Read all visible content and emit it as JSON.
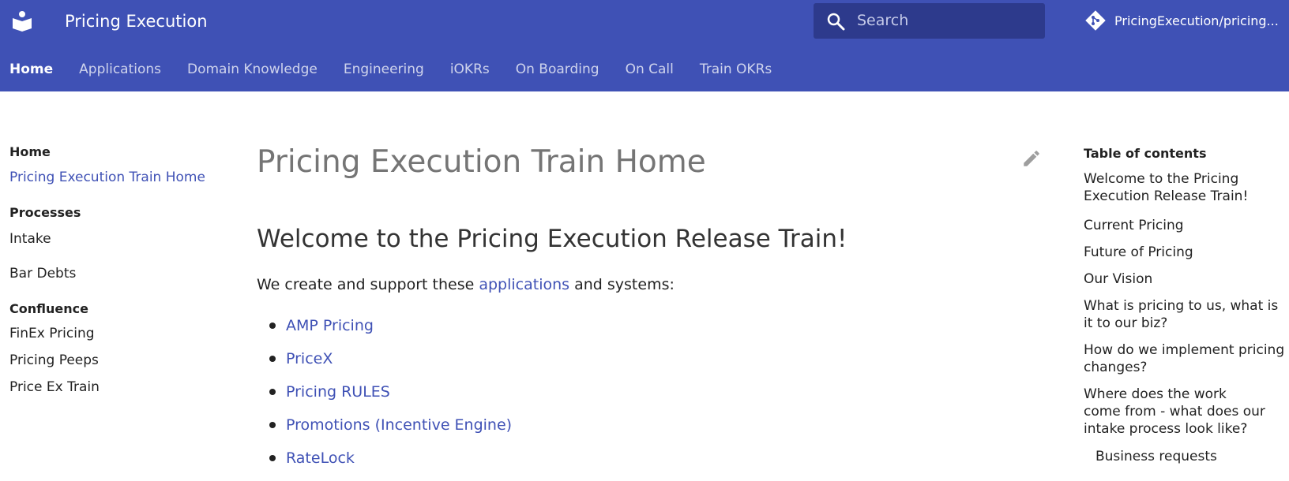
{
  "header": {
    "site_title": "Pricing Execution",
    "search_placeholder": "Search",
    "repo_label": "PricingExecution/pricing...",
    "tabs": [
      "Home",
      "Applications",
      "Domain Knowledge",
      "Engineering",
      "iOKRs",
      "On Boarding",
      "On Call",
      "Train OKRs"
    ],
    "active_tab": "Home",
    "colors": {
      "bar": "#3f51b5",
      "search": "#2d3a8c"
    }
  },
  "sidebar": {
    "sections": [
      {
        "title": "Home",
        "items": [
          "Pricing Execution Train Home"
        ]
      },
      {
        "title": "Processes",
        "items": [
          "Intake",
          "Bar Debts"
        ]
      },
      {
        "title": "Confluence",
        "items": [
          "FinEx Pricing",
          "Pricing Peeps",
          "Price Ex Train"
        ]
      }
    ]
  },
  "main": {
    "page_title": "Pricing Execution Train Home",
    "heading": "Welcome to the Pricing Execution Release Train!",
    "intro_prefix": "We create and support these ",
    "intro_link": "applications",
    "intro_suffix": " and systems:",
    "apps": [
      "AMP Pricing",
      "PriceX",
      "Pricing RULES",
      "Promotions (Incentive Engine)",
      "RateLock"
    ]
  },
  "toc": {
    "title": "Table of contents",
    "items": [
      "Welcome to the Pricing Execution Release Train!",
      "Current Pricing",
      "Future of Pricing",
      "Our Vision",
      "What is pricing to us, what is it to our biz?",
      "How do we implement pricing changes?",
      "Where does the work come from - what does our intake process look like?",
      "Business requests"
    ]
  },
  "icons": {
    "logo": "book-reader-icon",
    "search": "search-icon",
    "repo": "git-icon",
    "edit": "pencil-icon"
  }
}
